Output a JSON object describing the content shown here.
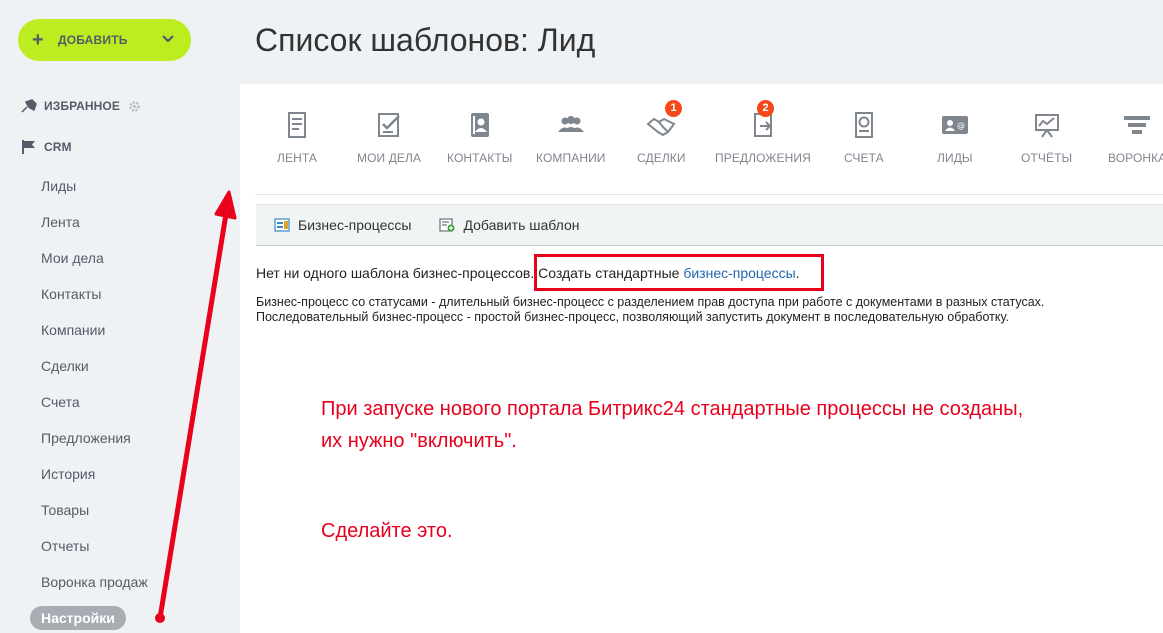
{
  "sidebar": {
    "add_button": "ДОБАВИТЬ",
    "favorites": "ИЗБРАННОЕ",
    "crm": "CRM",
    "items": [
      "Лиды",
      "Лента",
      "Мои дела",
      "Контакты",
      "Компании",
      "Сделки",
      "Счета",
      "Предложения",
      "История",
      "Товары",
      "Отчеты",
      "Воронка продаж"
    ],
    "active_item": "Настройки"
  },
  "header": {
    "title": "Список шаблонов: Лид"
  },
  "toolbar": {
    "items": [
      {
        "label": "ЛЕНТА",
        "icon": "feed-icon"
      },
      {
        "label": "МОИ ДЕЛА",
        "icon": "tasks-icon"
      },
      {
        "label": "КОНТАКТЫ",
        "icon": "contacts-icon"
      },
      {
        "label": "КОМПАНИИ",
        "icon": "companies-icon"
      },
      {
        "label": "СДЕЛКИ",
        "icon": "deals-icon",
        "badge": "1"
      },
      {
        "label": "ПРЕДЛОЖЕНИЯ",
        "icon": "quotes-icon",
        "badge": "2"
      },
      {
        "label": "СЧЕТА",
        "icon": "invoices-icon"
      },
      {
        "label": "ЛИДЫ",
        "icon": "leads-icon"
      },
      {
        "label": "ОТЧЁТЫ",
        "icon": "reports-icon"
      },
      {
        "label": "ВОРОНКА",
        "icon": "funnel-icon"
      }
    ]
  },
  "bp_bar": {
    "business_processes": "Бизнес-процессы",
    "add_template": "Добавить шаблон"
  },
  "message": {
    "prefix": "Нет ни одного шаблона бизнес-процессов.",
    "create": "Создать стандартные",
    "link": "бизнес-процессы",
    "suffix": "."
  },
  "description": {
    "line1": "Бизнес-процесс со статусами - длительный бизнес-процесс с разделением прав доступа при работе с документами в разных статусах.",
    "line2": "Последовательный бизнес-процесс - простой бизнес-процесс, позволяющий запустить документ в последовательную обработку."
  },
  "annotation": {
    "line1": "При запуске нового портала Битрикс24 стандартные процессы не созданы,",
    "line2": "их нужно \"включить\".",
    "line3": "Сделайте это."
  },
  "colors": {
    "accent_green": "#bbed21",
    "annotation_red": "#e8001c",
    "link_blue": "#2067b0",
    "badge_red": "#f54819"
  }
}
